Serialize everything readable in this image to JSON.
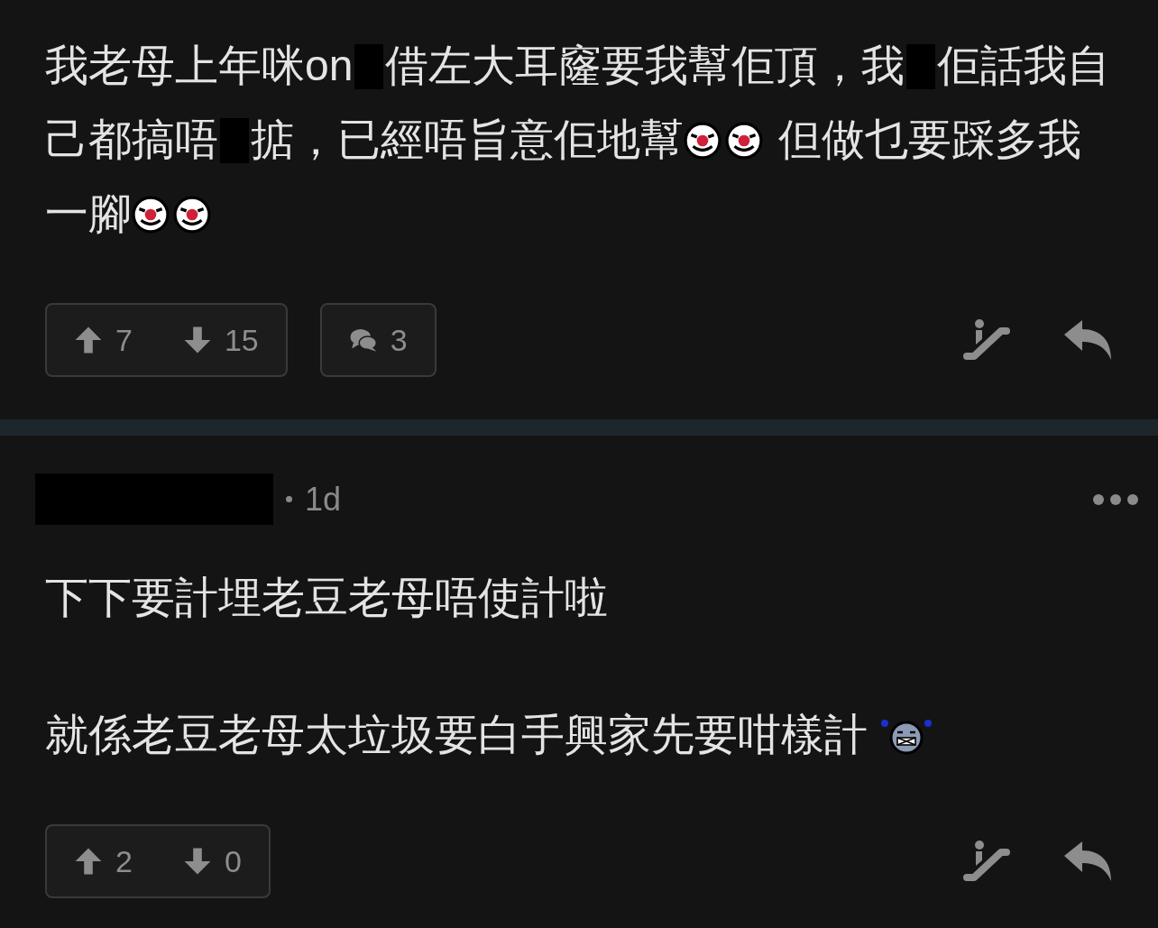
{
  "posts": [
    {
      "paragraphs": [
        [
          {
            "kind": "text",
            "text": "我老母上年咪on"
          },
          {
            "kind": "redacted"
          },
          {
            "kind": "text",
            "text": "借左大耳窿要我幫佢頂，我"
          },
          {
            "kind": "redacted"
          },
          {
            "kind": "text",
            "text": "佢話我自己都搞唔"
          },
          {
            "kind": "redacted"
          },
          {
            "kind": "text",
            "text": "掂，已經唔旨意佢地幫"
          },
          {
            "kind": "clown"
          },
          {
            "kind": "clown"
          },
          {
            "kind": "text",
            "text": " 但做乜要踩多我一腳"
          },
          {
            "kind": "clown"
          },
          {
            "kind": "clown"
          }
        ]
      ],
      "upvotes": "7",
      "downvotes": "15",
      "comments": "3"
    },
    {
      "header": {
        "time": "1d"
      },
      "paragraphs": [
        [
          {
            "kind": "text",
            "text": "下下要計埋老豆老母唔使計啦"
          }
        ],
        [
          {
            "kind": "text",
            "text": "就係老豆老母太垃圾要白手興家先要咁樣計 "
          },
          {
            "kind": "angry"
          }
        ]
      ],
      "upvotes": "2",
      "downvotes": "0"
    }
  ]
}
